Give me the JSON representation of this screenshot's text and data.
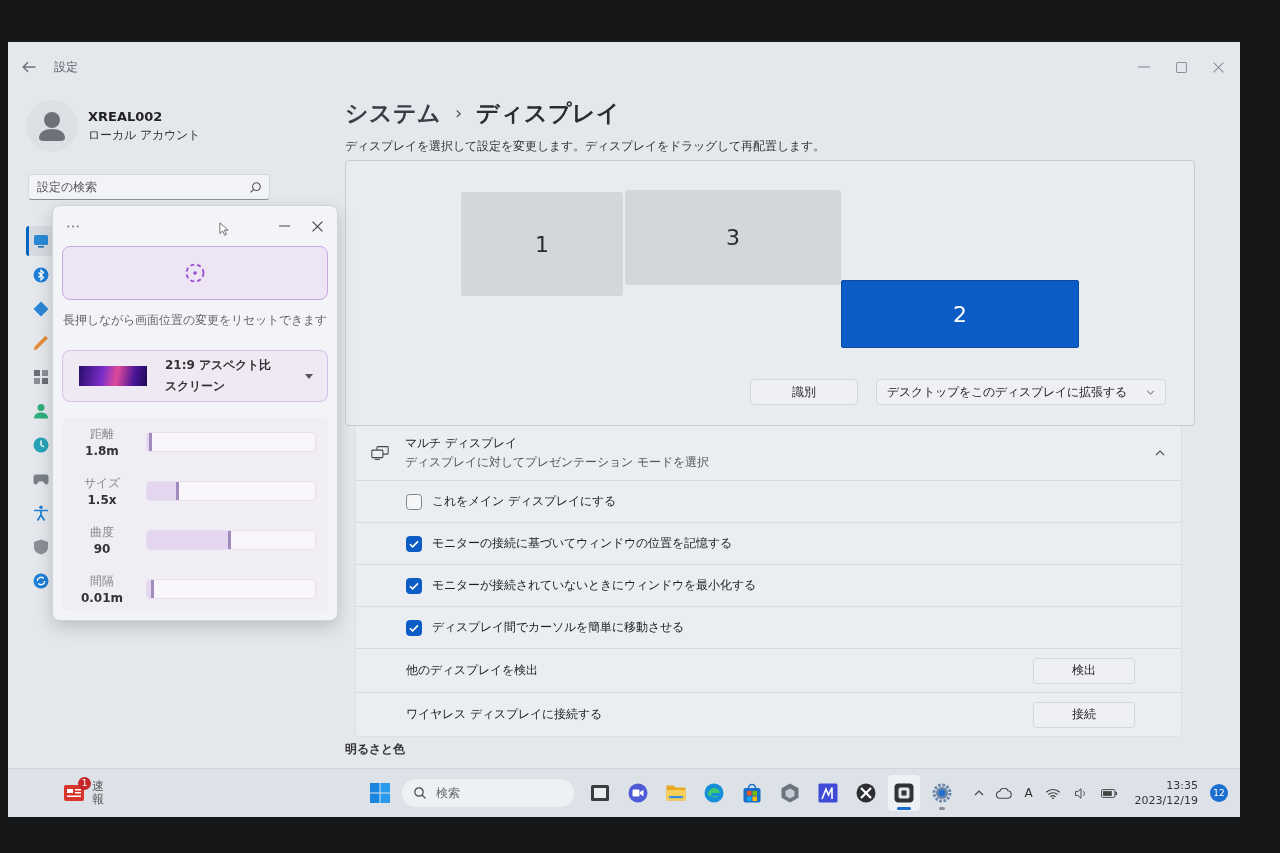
{
  "window": {
    "title": "設定"
  },
  "account": {
    "name": "XREAL002",
    "type": "ローカル アカウント"
  },
  "sidebar": {
    "search": {
      "placeholder": "設定の検索"
    },
    "items": [
      {
        "selected": true
      },
      {
        "selected": false
      },
      {
        "selected": false
      },
      {
        "selected": false
      },
      {
        "selected": false
      },
      {
        "selected": false
      },
      {
        "selected": false
      },
      {
        "selected": false
      },
      {
        "selected": false
      },
      {
        "selected": false
      },
      {
        "selected": false
      }
    ]
  },
  "page": {
    "breadcrumb": {
      "parent": "システム",
      "separator": "›",
      "current": "ディスプレイ"
    },
    "description": "ディスプレイを選択して設定を変更します。ディスプレイをドラッグして再配置します。",
    "monitors": [
      {
        "label": "1",
        "selected": false
      },
      {
        "label": "3",
        "selected": false
      },
      {
        "label": "2",
        "selected": true
      }
    ],
    "identify_button": "識別",
    "mode_dropdown": {
      "value": "デスクトップをこのディスプレイに拡張する"
    },
    "multi_display": {
      "title": "マルチ ディスプレイ",
      "subtitle": "ディスプレイに対してプレゼンテーション モードを選択",
      "expanded": true,
      "rows": [
        {
          "kind": "checkbox",
          "label": "これをメイン ディスプレイにする",
          "checked": false
        },
        {
          "kind": "checkbox",
          "label": "モニターの接続に基づいてウィンドウの位置を記憶する",
          "checked": true
        },
        {
          "kind": "checkbox",
          "label": "モニターが接続されていないときにウィンドウを最小化する",
          "checked": true
        },
        {
          "kind": "checkbox",
          "label": "ディスプレイ間でカーソルを簡単に移動させる",
          "checked": true
        },
        {
          "kind": "button",
          "label": "他のディスプレイを検出",
          "button": "検出"
        },
        {
          "kind": "button",
          "label": "ワイヤレス ディスプレイに接続する",
          "button": "接続"
        }
      ]
    },
    "next_section": "明るさと色"
  },
  "overlay_window": {
    "hint": "長押しながら画面位置の変更をリセットできます",
    "screen_mode": {
      "title": "21:9 アスペクト比",
      "subtitle": "スクリーン"
    },
    "sliders": [
      {
        "label": "距離",
        "reading": "1.8m",
        "level": 0.03
      },
      {
        "label": "サイズ",
        "reading": "1.5x",
        "level": 0.19
      },
      {
        "label": "曲度",
        "reading": "90",
        "level": 0.5
      },
      {
        "label": "間隔",
        "reading": "0.01m",
        "level": 0.04
      }
    ]
  },
  "taskbar": {
    "widget": {
      "badge": "1",
      "text": "速報"
    },
    "search": {
      "placeholder": "検索"
    },
    "apps": [
      {
        "active": false,
        "running": false
      },
      {
        "active": false,
        "running": false
      },
      {
        "active": false,
        "running": false
      },
      {
        "active": false,
        "running": false
      },
      {
        "active": false,
        "running": false
      },
      {
        "active": false,
        "running": false
      },
      {
        "active": false,
        "running": false
      },
      {
        "active": false,
        "running": false
      },
      {
        "active": true,
        "running": true
      },
      {
        "active": false,
        "running": true
      }
    ],
    "ime": "A",
    "time": "13:35",
    "date": "2023/12/19",
    "notifications": "12"
  }
}
